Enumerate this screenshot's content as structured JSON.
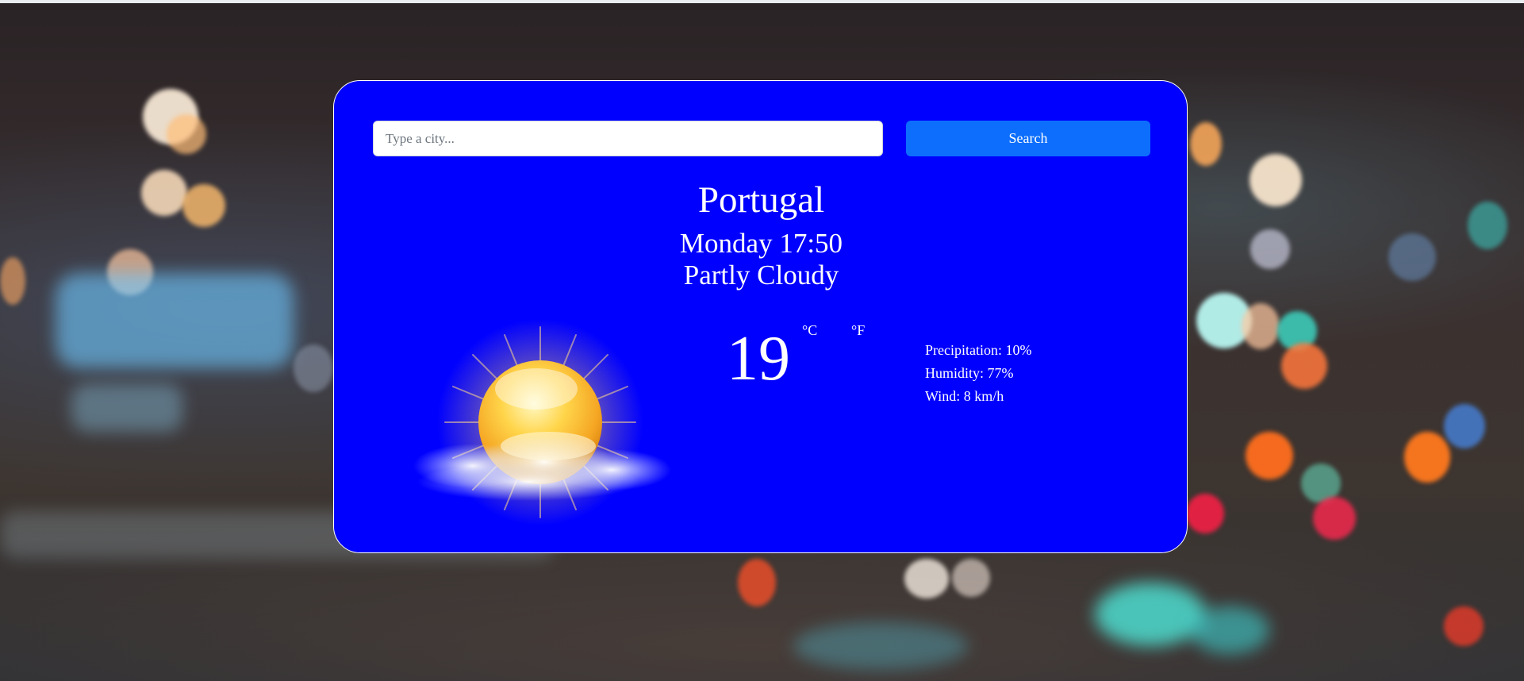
{
  "search": {
    "placeholder": "Type a city...",
    "value": "",
    "button_label": "Search"
  },
  "weather": {
    "city": "Portugal",
    "datetime": "Monday 17:50",
    "condition": "Partly Cloudy",
    "icon": "partly-cloudy-sun-icon",
    "temperature": "19",
    "unit_celsius": "°C",
    "unit_fahrenheit": "°F",
    "precipitation": "Precipitation: 10%",
    "humidity": "Humidity: 77%",
    "wind": "Wind: 8 km/h"
  },
  "colors": {
    "card_background": "#0000ff",
    "search_button": "#0d6efd",
    "text": "#ffffff"
  }
}
